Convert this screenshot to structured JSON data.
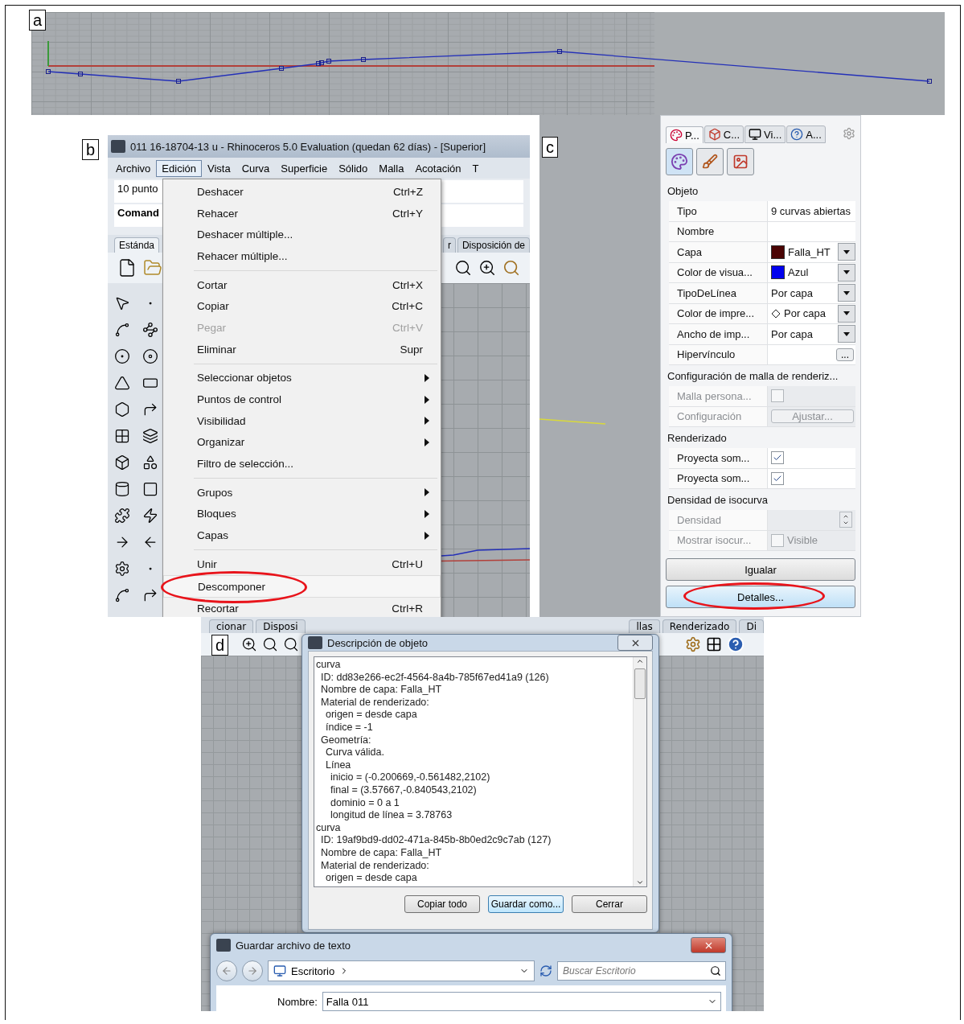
{
  "panel_a": {
    "label": "a"
  },
  "panel_b": {
    "label": "b",
    "window_title": "011 16-18704-13 u - Rhinoceros 5.0 Evaluation (quedan 62 días) - [Superior]",
    "menu_bar": [
      {
        "label": "Archivo",
        "selected": false
      },
      {
        "label": "Edición",
        "selected": true
      },
      {
        "label": "Vista",
        "selected": false
      },
      {
        "label": "Curva",
        "selected": false
      },
      {
        "label": "Superficie",
        "selected": false
      },
      {
        "label": "Sólido",
        "selected": false
      },
      {
        "label": "Malla",
        "selected": false
      },
      {
        "label": "Acotación",
        "selected": false
      },
      {
        "label": "T",
        "selected": false
      }
    ],
    "command_history": "10 punto",
    "command_prompt": "Comand",
    "toolbar_tabs": [
      {
        "label": "Estánda",
        "selected": true
      },
      {
        "label": "r",
        "selected": false
      },
      {
        "label": "Disposición de",
        "selected": false
      }
    ],
    "edit_menu": [
      [
        {
          "label": "Deshacer",
          "shortcut": "Ctrl+Z",
          "disabled": false,
          "submenu": false,
          "circled": false
        },
        {
          "label": "Rehacer",
          "shortcut": "Ctrl+Y",
          "disabled": false,
          "submenu": false,
          "circled": false
        },
        {
          "label": "Deshacer múltiple...",
          "disabled": false,
          "submenu": false,
          "circled": false
        },
        {
          "label": "Rehacer múltiple...",
          "disabled": false,
          "submenu": false,
          "circled": false
        }
      ],
      [
        {
          "label": "Cortar",
          "shortcut": "Ctrl+X",
          "disabled": false,
          "submenu": false,
          "circled": false
        },
        {
          "label": "Copiar",
          "shortcut": "Ctrl+C",
          "disabled": false,
          "submenu": false,
          "circled": false
        },
        {
          "label": "Pegar",
          "shortcut": "Ctrl+V",
          "disabled": true,
          "submenu": false,
          "circled": false
        },
        {
          "label": "Eliminar",
          "shortcut": "Supr",
          "disabled": false,
          "submenu": false,
          "circled": false
        }
      ],
      [
        {
          "label": "Seleccionar objetos",
          "disabled": false,
          "submenu": true,
          "circled": false
        },
        {
          "label": "Puntos de control",
          "disabled": false,
          "submenu": true,
          "circled": false
        },
        {
          "label": "Visibilidad",
          "disabled": false,
          "submenu": true,
          "circled": false
        },
        {
          "label": "Organizar",
          "disabled": false,
          "submenu": true,
          "circled": false
        },
        {
          "label": "Filtro de selección...",
          "disabled": false,
          "submenu": false,
          "circled": false
        }
      ],
      [
        {
          "label": "Grupos",
          "disabled": false,
          "submenu": true,
          "circled": false
        },
        {
          "label": "Bloques",
          "disabled": false,
          "submenu": true,
          "circled": false
        },
        {
          "label": "Capas",
          "disabled": false,
          "submenu": true,
          "circled": false
        }
      ],
      [
        {
          "label": "Unir",
          "shortcut": "Ctrl+U",
          "disabled": false,
          "submenu": false,
          "circled": false
        },
        {
          "label": "Descomponer",
          "disabled": false,
          "submenu": false,
          "circled": true
        },
        {
          "label": "Recortar",
          "shortcut": "Ctrl+R",
          "disabled": false,
          "submenu": false,
          "circled": false
        }
      ]
    ]
  },
  "panel_c": {
    "label": "c",
    "tabs": [
      {
        "label": "P...",
        "selected": true
      },
      {
        "label": "C...",
        "selected": false
      },
      {
        "label": "Vi...",
        "selected": false
      },
      {
        "label": "A...",
        "selected": false
      }
    ],
    "sections": [
      {
        "title": "Objeto",
        "rows": [
          {
            "kind": "text",
            "label": "Tipo",
            "value": "9 curvas abiertas",
            "dropdown": false,
            "disabled": false
          },
          {
            "kind": "text",
            "label": "Nombre",
            "dropdown": false,
            "disabled": false
          },
          {
            "kind": "swatch",
            "label": "Capa",
            "value": "Falla_HT",
            "color": "#4a0404",
            "dropdown": true,
            "disabled": false
          },
          {
            "kind": "swatch",
            "label": "Color de visua...",
            "value": "Azul",
            "color": "#0000ee",
            "dropdown": true,
            "disabled": false
          },
          {
            "kind": "text",
            "label": "TipoDeLínea",
            "value": "Por capa",
            "dropdown": true,
            "disabled": false
          },
          {
            "kind": "diamond",
            "label": "Color de impre...",
            "value": "Por capa",
            "dropdown": true,
            "disabled": false
          },
          {
            "kind": "text",
            "label": "Ancho de imp...",
            "value": "Por capa",
            "dropdown": true,
            "disabled": false
          },
          {
            "kind": "more",
            "label": "Hipervínculo",
            "value": "...",
            "dropdown": false,
            "disabled": false
          }
        ]
      },
      {
        "title": "Configuración de malla de renderiz...",
        "rows": [
          {
            "kind": "checkbox",
            "label": "Malla persona...",
            "checked": false,
            "dropdown": false,
            "disabled": true
          },
          {
            "kind": "button",
            "label": "Configuración",
            "value": "Ajustar...",
            "dropdown": false,
            "disabled": true
          }
        ]
      },
      {
        "title": "Renderizado",
        "rows": [
          {
            "kind": "checkbox",
            "label": "Proyecta som...",
            "checked": true,
            "dropdown": false,
            "disabled": false
          },
          {
            "kind": "checkbox",
            "label": "Proyecta som...",
            "checked": true,
            "dropdown": false,
            "disabled": false
          }
        ]
      },
      {
        "title": "Densidad de isocurva",
        "rows": [
          {
            "kind": "spinner",
            "label": "Densidad",
            "dropdown": false,
            "disabled": true
          },
          {
            "kind": "checkbox",
            "label": "Mostrar isocur...",
            "value": "Visible",
            "checked": false,
            "dropdown": false,
            "disabled": true
          }
        ]
      }
    ],
    "buttons": [
      {
        "label": "Igualar",
        "circled": false,
        "selected": false
      },
      {
        "label": "Detalles...",
        "circled": true,
        "selected": true
      }
    ]
  },
  "panel_d": {
    "label": "d",
    "toolbar_tabs": [
      "cionar",
      "Disposi",
      "llas",
      "Renderizado",
      "Di"
    ],
    "description_dialog": {
      "title": "Descripción de objeto",
      "listing": [
        {
          "text": "curva",
          "children": [
            {
              "text": "ID: dd83e266-ec2f-4564-8a4b-785f67ed41a9 (126)"
            },
            {
              "text": "Nombre de capa: Falla_HT"
            },
            {
              "text": "Material de renderizado:",
              "children": [
                {
                  "text": "origen = desde capa"
                },
                {
                  "text": "índice = -1"
                }
              ]
            },
            {
              "text": "Geometría:",
              "children": [
                {
                  "text": "Curva válida."
                },
                {
                  "text": "Línea",
                  "children": [
                    {
                      "text": "inicio = (-0.200669,-0.561482,2102)"
                    },
                    {
                      "text": "final = (3.57667,-0.840543,2102)"
                    },
                    {
                      "text": "dominio = 0 a 1"
                    },
                    {
                      "text": "longitud de línea = 3.78763"
                    }
                  ]
                }
              ]
            }
          ]
        },
        {
          "text": "curva",
          "children": [
            {
              "text": "ID: 19af9bd9-dd02-471a-845b-8b0ed2c9c7ab (127)"
            },
            {
              "text": "Nombre de capa: Falla_HT"
            },
            {
              "text": "Material de renderizado:",
              "children": [
                {
                  "text": "origen = desde capa"
                }
              ]
            }
          ]
        }
      ],
      "buttons": [
        {
          "label": "Copiar todo",
          "selected": false
        },
        {
          "label": "Guardar como...",
          "selected": true
        },
        {
          "label": "Cerrar",
          "selected": false
        }
      ]
    },
    "save_dialog": {
      "title": "Guardar archivo de texto",
      "location": "Escritorio",
      "search": {
        "placeholder": "Buscar Escritorio"
      },
      "name_label": "Nombre:",
      "name_value": "Falla 011"
    }
  }
}
